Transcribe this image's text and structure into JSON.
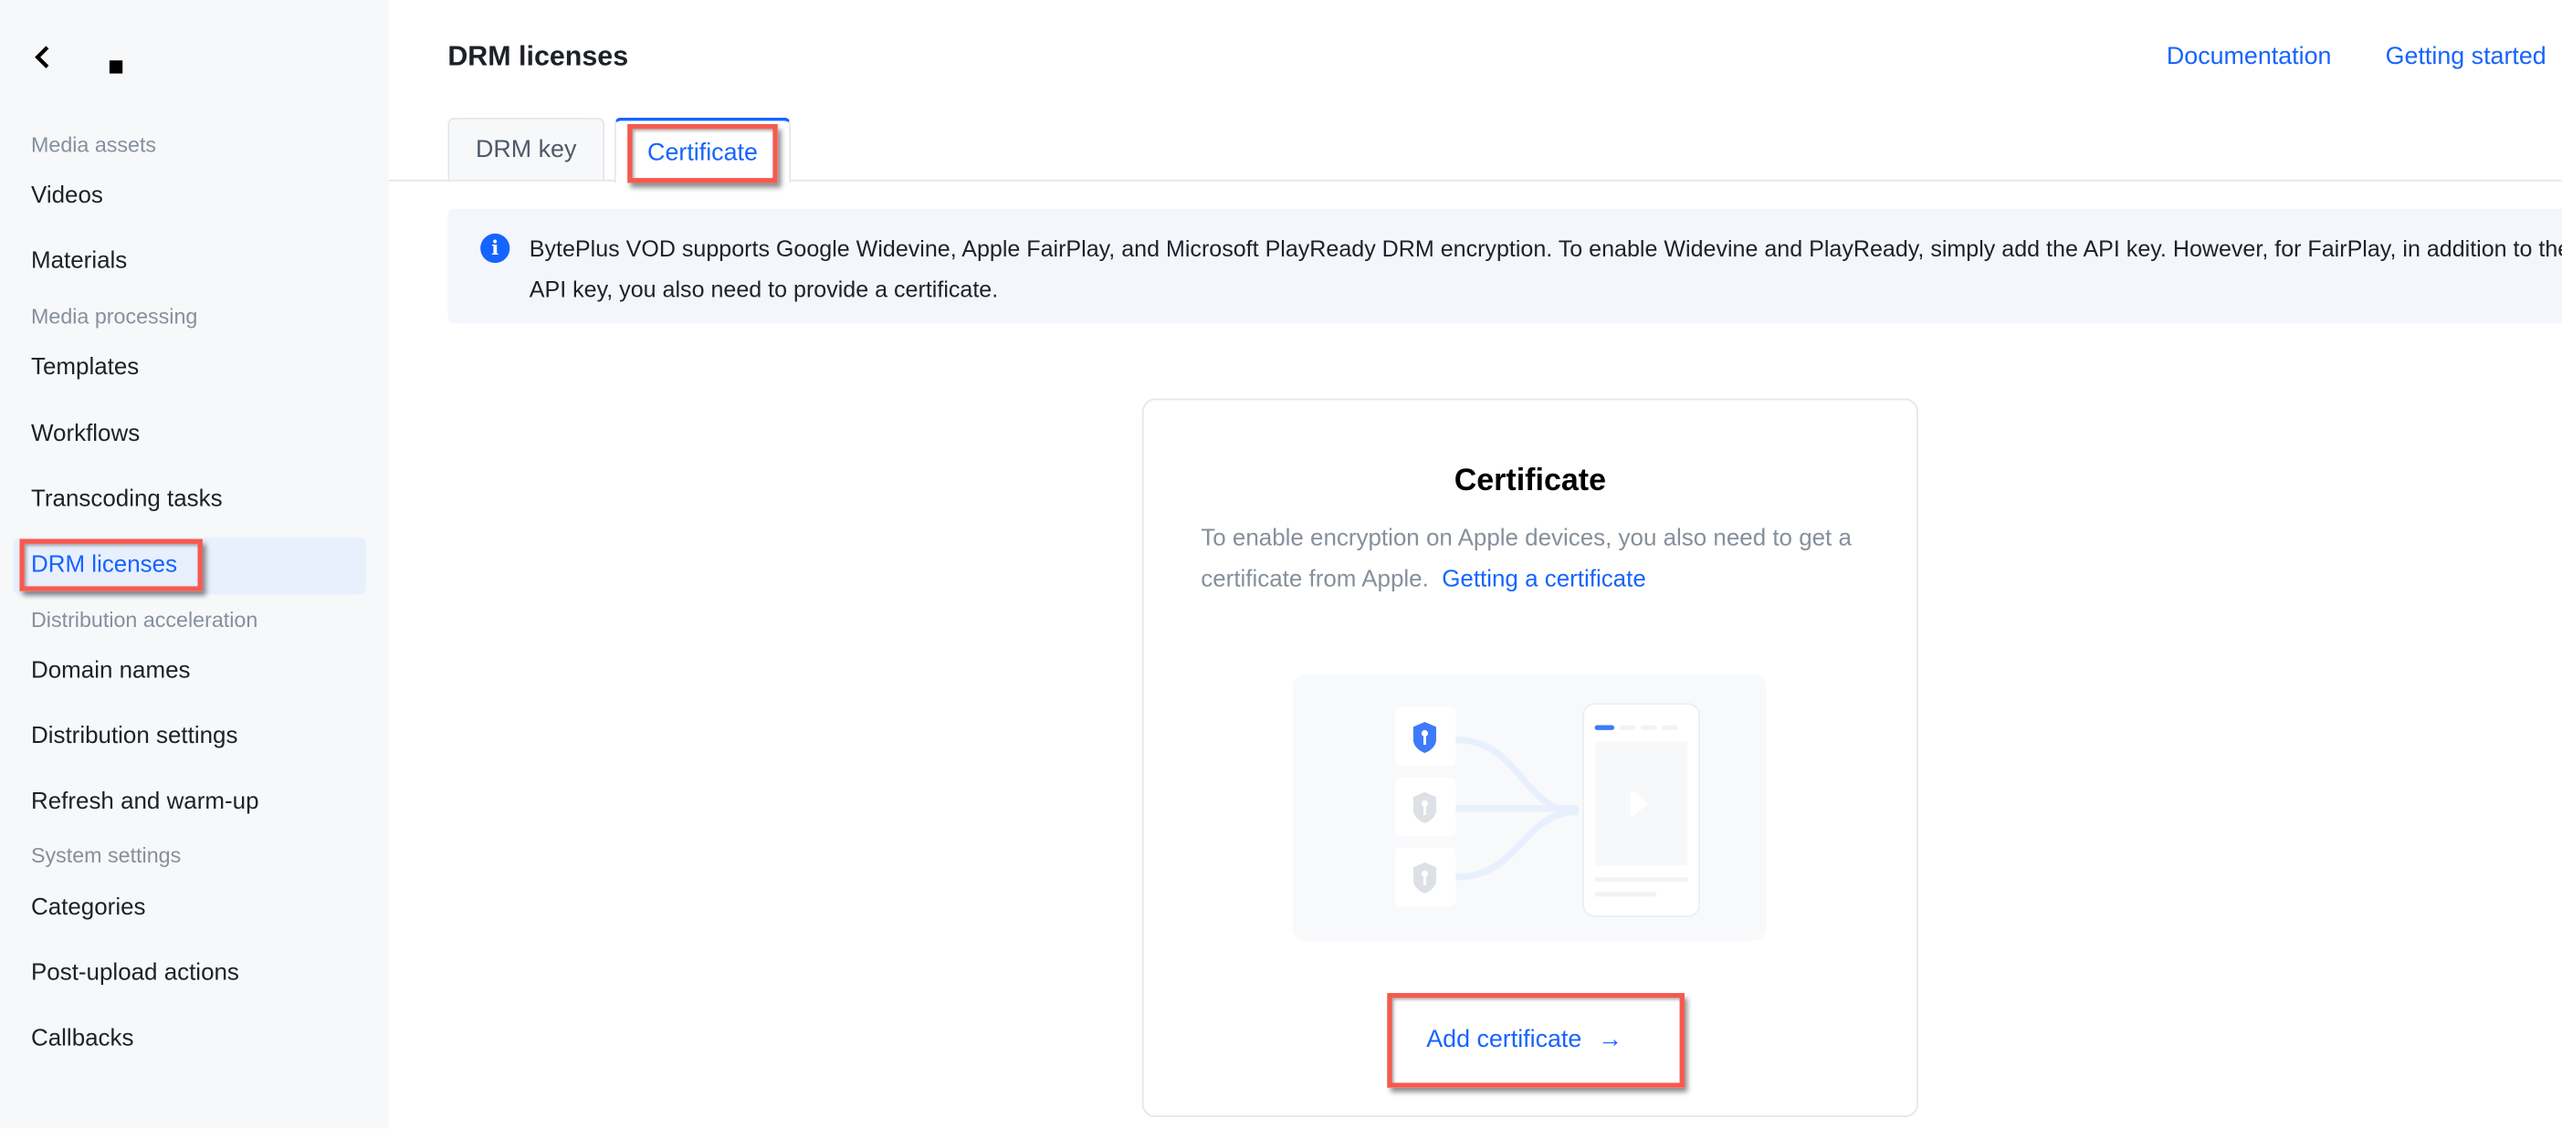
{
  "colors": {
    "accent": "#1664ff",
    "highlight_box": "#f55a4e",
    "sidebar_bg": "#f7f8fa",
    "banner_bg": "#f3f6fd"
  },
  "sidebar": {
    "back_icon": "chevron-left-icon",
    "groups": [
      {
        "label": "Media assets",
        "items": [
          "Videos",
          "Materials"
        ]
      },
      {
        "label": "Media processing",
        "items": [
          "Templates",
          "Workflows",
          "Transcoding tasks",
          "DRM licenses"
        ]
      },
      {
        "label": "Distribution acceleration",
        "items": [
          "Domain names",
          "Distribution settings",
          "Refresh and warm-up"
        ]
      },
      {
        "label": "System settings",
        "items": [
          "Categories",
          "Post-upload actions",
          "Callbacks"
        ]
      }
    ],
    "active_item": "DRM licenses"
  },
  "header": {
    "title": "DRM licenses",
    "links": [
      "Documentation",
      "Getting started"
    ]
  },
  "tabs": [
    {
      "label": "DRM key"
    },
    {
      "label": "Certificate",
      "active": true
    }
  ],
  "banner": {
    "icon": "info-icon",
    "text": "BytePlus VOD supports Google Widevine, Apple FairPlay, and Microsoft PlayReady DRM encryption. To enable Widevine and PlayReady, simply add the API key. However, for FairPlay, in addition to the API key, you also need to provide a certificate."
  },
  "card": {
    "title": "Certificate",
    "description": "To enable encryption on Apple devices, you also need to get a certificate from Apple.",
    "link": "Getting a certificate",
    "button": "Add certificate",
    "button_icon": "arrow-right-icon",
    "button_arrow": "→"
  }
}
